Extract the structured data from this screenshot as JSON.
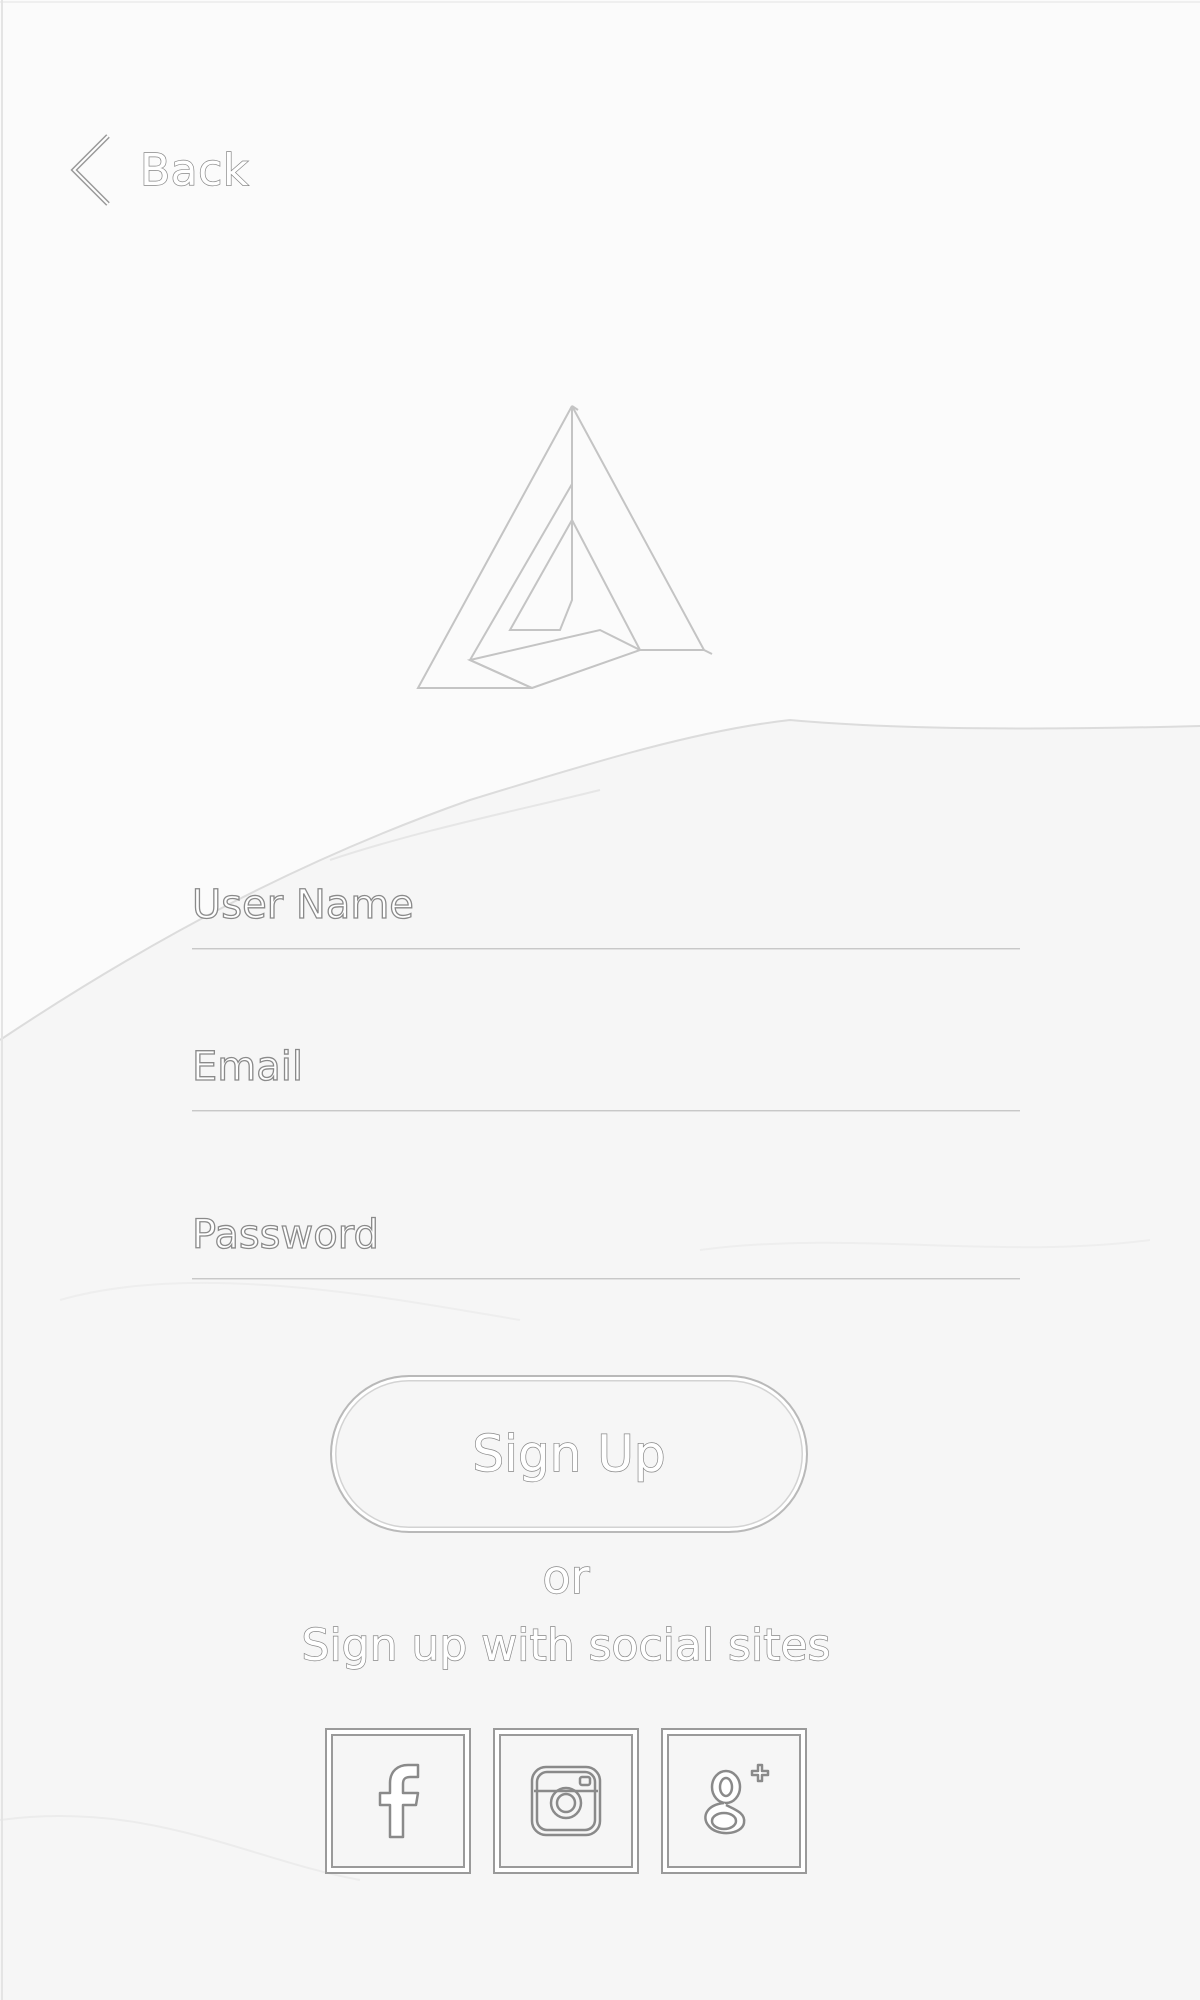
{
  "header": {
    "back_label": "Back"
  },
  "form": {
    "username_placeholder": "User Name",
    "email_placeholder": "Email",
    "password_placeholder": "Password",
    "signup_label": "Sign Up"
  },
  "social": {
    "or_label": "or",
    "caption": "Sign up with social sites",
    "buttons": [
      {
        "icon": "facebook-icon"
      },
      {
        "icon": "instagram-icon"
      },
      {
        "icon": "google-plus-icon"
      }
    ]
  },
  "colors": {
    "outline": "#8a8a8a",
    "line": "#c8c8c8",
    "background": "#fbfbfb"
  }
}
